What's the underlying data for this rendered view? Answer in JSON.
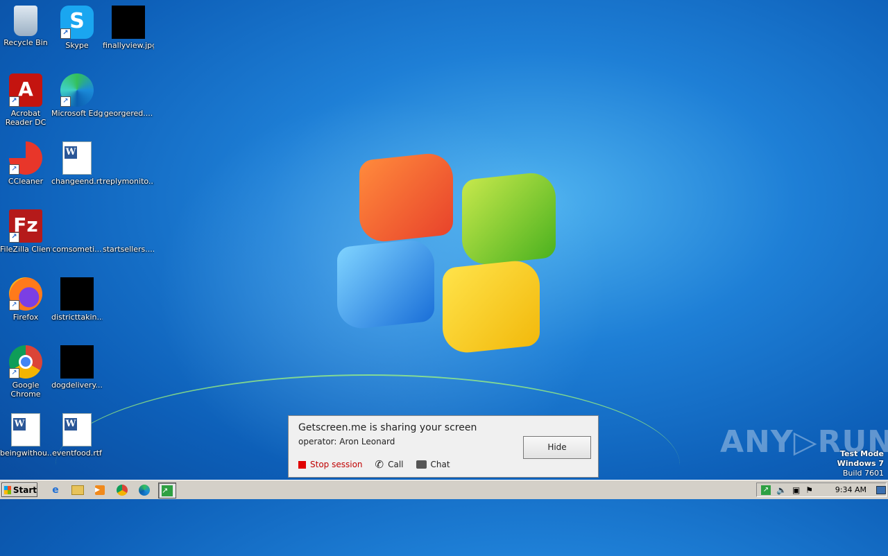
{
  "desktop_icons": [
    {
      "label": "Recycle Bin"
    },
    {
      "label": "Skype"
    },
    {
      "label": "finallyview.jpg"
    },
    {
      "label": "Acrobat Reader DC"
    },
    {
      "label": "Microsoft Edge"
    },
    {
      "label": "georgered...."
    },
    {
      "label": "CCleaner"
    },
    {
      "label": "changeend.rtf"
    },
    {
      "label": "replymonito..."
    },
    {
      "label": "FileZilla Client"
    },
    {
      "label": "comsometi..."
    },
    {
      "label": "startsellers...."
    },
    {
      "label": "Firefox"
    },
    {
      "label": "districttakin..."
    },
    {
      "label": "Google Chrome"
    },
    {
      "label": "dogdelivery..."
    },
    {
      "label": "beingwithou..."
    },
    {
      "label": "eventfood.rtf"
    }
  ],
  "dialog": {
    "title": "Getscreen.me is sharing your screen",
    "operator": "operator: Aron Leonard",
    "stop_label": "Stop session",
    "call_label": "Call",
    "chat_label": "Chat",
    "hide_label": "Hide"
  },
  "watermark": {
    "brand": "ANY▷RUN",
    "test_mode": "Test Mode",
    "os": "Windows 7",
    "build": "Build 7601"
  },
  "taskbar": {
    "start_label": "Start",
    "clock": "9:34 AM",
    "quick_launch": [
      "ie-icon",
      "explorer-icon",
      "media-player-icon",
      "chrome-icon",
      "edge-icon",
      "getscreen-icon"
    ],
    "tray": [
      "getscreen-tray-icon",
      "volume-icon",
      "network-icon",
      "action-center-flag-icon",
      "show-desktop-icon"
    ]
  }
}
